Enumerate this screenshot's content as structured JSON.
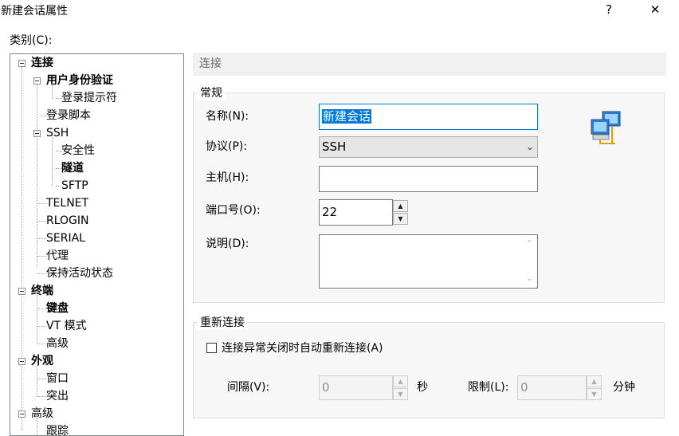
{
  "window": {
    "title": "新建会话属性",
    "help_label": "?",
    "close_label": "✕"
  },
  "category_label": "类别(C):",
  "tree": {
    "items": [
      {
        "label": "连接",
        "bold": true
      },
      {
        "label": "用户身份验证",
        "bold": true
      },
      {
        "label": "登录提示符",
        "bold": false
      },
      {
        "label": "登录脚本",
        "bold": false
      },
      {
        "label": "SSH",
        "bold": false
      },
      {
        "label": "安全性",
        "bold": false
      },
      {
        "label": "隧道",
        "bold": true
      },
      {
        "label": "SFTP",
        "bold": false
      },
      {
        "label": "TELNET",
        "bold": false
      },
      {
        "label": "RLOGIN",
        "bold": false
      },
      {
        "label": "SERIAL",
        "bold": false
      },
      {
        "label": "代理",
        "bold": false
      },
      {
        "label": "保持活动状态",
        "bold": false
      },
      {
        "label": "终端",
        "bold": true
      },
      {
        "label": "键盘",
        "bold": true
      },
      {
        "label": "VT 模式",
        "bold": false
      },
      {
        "label": "高级",
        "bold": false
      },
      {
        "label": "外观",
        "bold": true
      },
      {
        "label": "窗口",
        "bold": false
      },
      {
        "label": "突出",
        "bold": false
      },
      {
        "label": "高级",
        "bold": false
      },
      {
        "label": "跟踪",
        "bold": false
      }
    ]
  },
  "section_header": "连接",
  "general": {
    "title": "常规",
    "name_label": "名称(N):",
    "name_value": "新建会话",
    "protocol_label": "协议(P):",
    "protocol_value": "SSH",
    "host_label": "主机(H):",
    "host_value": "",
    "port_label": "端口号(O):",
    "port_value": "22",
    "desc_label": "说明(D):",
    "desc_value": "",
    "icon": "network-computers-icon"
  },
  "reconnect": {
    "title": "重新连接",
    "checkbox_label": "连接异常关闭时自动重新连接(A)",
    "checked": false,
    "interval_label": "间隔(V):",
    "interval_value": "0",
    "interval_unit": "秒",
    "limit_label": "限制(L):",
    "limit_value": "0",
    "limit_unit": "分钟"
  }
}
